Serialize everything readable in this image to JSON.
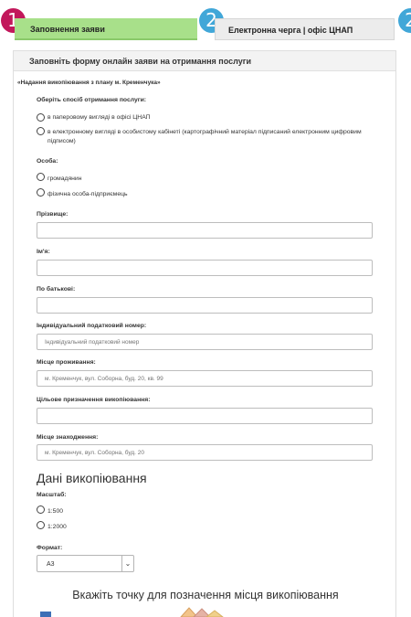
{
  "steps": [
    {
      "number": "1",
      "label": "Заповнення заяви"
    },
    {
      "number": "2",
      "label": "Електронна черга | офіс ЦНАП"
    },
    {
      "number": "2"
    }
  ],
  "form": {
    "header": "Заповніть форму онлайн заяви на отримання послуги",
    "service": "«Надання викопіювання з плану м. Кременчука»",
    "delivery": {
      "label": "Оберіть спосіб отримання послуги:",
      "options": [
        "в паперовому вигляді в офісі ЦНАП",
        "в електронному вигляді в особистому кабінеті (картографічний матеріал підписаний електронним цифровим підписом)"
      ]
    },
    "person": {
      "label": "Особа:",
      "options": [
        "громадянин",
        "фізична особа-підприємець"
      ]
    },
    "surname": {
      "label": "Прізвище:",
      "placeholder": ""
    },
    "name": {
      "label": "Ім'я:",
      "placeholder": ""
    },
    "patronymic": {
      "label": "По батькові:",
      "placeholder": ""
    },
    "tax_id": {
      "label": "Індивідуальний податковий номер:",
      "placeholder": "Індивідуальний податковий номер"
    },
    "residence": {
      "label": "Місце проживання:",
      "placeholder": "м. Кременчук, вул. Соборна, буд. 20, кв. 99"
    },
    "purpose": {
      "label": "Цільове призначення викопіювання:",
      "placeholder": ""
    },
    "location": {
      "label": "Місце знаходження:",
      "placeholder": "м. Кременчук, вул. Соборна, буд. 20"
    }
  },
  "copy": {
    "title": "Дані викопіювання",
    "scale": {
      "label": "Масштаб:",
      "options": [
        "1:500",
        "1:2000"
      ]
    },
    "format": {
      "label": "Формат:",
      "value": "А3"
    }
  },
  "map": {
    "title": "Вкажіть точку для позначення місця викопіювання"
  },
  "colors": {
    "step_active": "#c2185b",
    "step_inactive": "#41a7d8",
    "tab_active": "#a8e08a"
  }
}
